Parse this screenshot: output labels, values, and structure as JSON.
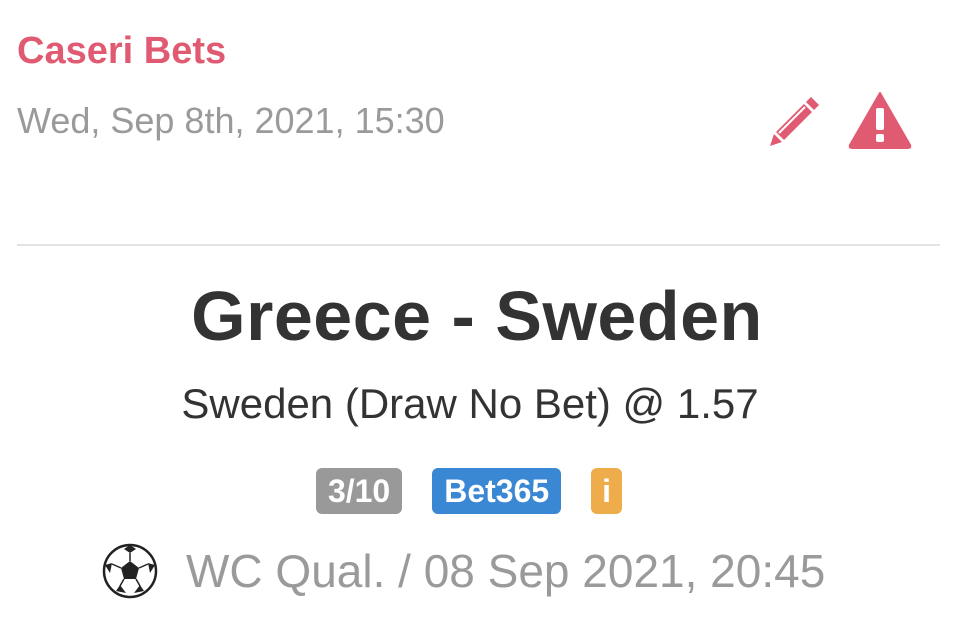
{
  "tip": {
    "author": "Caseri Bets",
    "posted_at": "Wed, Sep 8th, 2021, 15:30",
    "match": "Greece - Sweden",
    "pick": "Sweden (Draw No Bet) @ 1.57",
    "badges": {
      "stake": "3/10",
      "bookmaker": "Bet365",
      "info": "i"
    },
    "meta": "WC Qual. / 08 Sep 2021, 20:45"
  },
  "icons": {
    "edit": "pencil-icon",
    "report": "warning-triangle-icon",
    "sport": "soccer-ball-icon"
  },
  "colors": {
    "accent": "#e05a72",
    "muted_text": "#9a9a9a",
    "stake_badge": "#999999",
    "bookmaker_badge": "#3a87d4",
    "info_badge": "#efac4a"
  }
}
